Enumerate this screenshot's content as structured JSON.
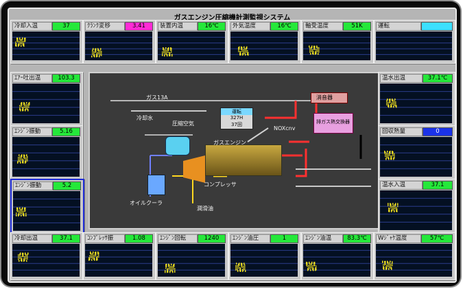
{
  "title": "ガスエンジン圧縮機計測監視システム",
  "panels": [
    {
      "id": "p1",
      "label": "冷却入温",
      "value": "37",
      "value_color": "#25e83a"
    },
    {
      "id": "p2",
      "label": "ｸﾗﾝｸ変移",
      "value": "3.41",
      "value_color": "#ff2bd6"
    },
    {
      "id": "p3",
      "label": "装置内温",
      "value": "16℃",
      "value_color": "#25e83a"
    },
    {
      "id": "p4",
      "label": "外気温度",
      "value": "16℃",
      "value_color": "#25e83a"
    },
    {
      "id": "p5",
      "label": "軸受温度",
      "value": "51K",
      "value_color": "#25e83a"
    },
    {
      "id": "p6",
      "label": "運転",
      "value": "",
      "value_color": "#3ce0ff"
    },
    {
      "id": "p7",
      "label": "ｴｱｰ吐出温",
      "value": "103.3",
      "value_color": "#25e83a"
    },
    {
      "id": "p8",
      "label": "ｴﾝｼﾞﾝ振動",
      "value": "5.16",
      "value_color": "#25e83a"
    },
    {
      "id": "p9",
      "label": "ｴﾝｼﾞﾝ振動",
      "value": "5.2",
      "value_color": "#25e83a"
    },
    {
      "id": "p10",
      "label": "温水出温",
      "value": "37.1℃",
      "value_color": "#25e83a"
    },
    {
      "id": "p11",
      "label": "回収熱量",
      "value": "0",
      "value_color": "#1a32e8"
    },
    {
      "id": "p12",
      "label": "温水入温",
      "value": "37.1",
      "value_color": "#25e83a"
    },
    {
      "id": "p13",
      "label": "冷却出温",
      "value": "37.1",
      "value_color": "#25e83a"
    },
    {
      "id": "p14",
      "label": "ｺﾝﾌﾟﾚｯｻ振",
      "value": "1.08",
      "value_color": "#25e83a"
    },
    {
      "id": "p15",
      "label": "ｴﾝｼﾞﾝ回転",
      "value": "1240",
      "value_color": "#25e83a"
    },
    {
      "id": "p16",
      "label": "ｴﾝｼﾞﾝ油圧",
      "value": "1",
      "value_color": "#25e83a"
    },
    {
      "id": "p17",
      "label": "ｴﾝｼﾞﾝ油温",
      "value": "83.3℃",
      "value_color": "#25e83a"
    },
    {
      "id": "p18",
      "label": "Wｼﾞｬｹ温度",
      "value": "57℃",
      "value_color": "#25e83a"
    }
  ],
  "diagram": {
    "gas_label": "ガス13A",
    "cooling_water": "冷却水",
    "compressed_air": "圧縮空気",
    "gas_engine": "ガスエンジン",
    "compressor": "コンプレッサ",
    "oil_cooler": "オイルクーラ",
    "lube_oil": "潤滑油",
    "muffler": "消音器",
    "nox_conv": "NOXcnv",
    "heat_exchanger": "排ガス熱交換器",
    "run_title": "運転",
    "run_line1": "327H",
    "run_line2": "37回"
  },
  "colors": {
    "graph_bg": "#041022",
    "trace": "#f0e020",
    "grid": "#2b3c8c"
  }
}
